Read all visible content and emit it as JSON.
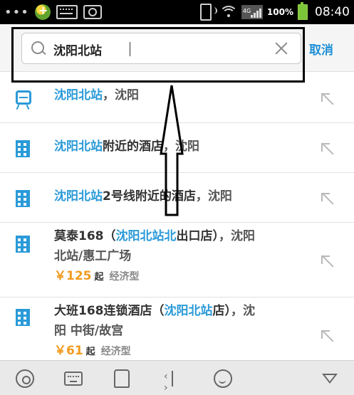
{
  "status_bar": {
    "overflow_dots": "•••",
    "battery_percent": "100%",
    "time": "08:40",
    "network_label": "4G",
    "icons": [
      "app-notification-icon",
      "keyboard-icon",
      "screenshot-icon",
      "phone-vibrate-icon",
      "wifi-icon",
      "signal-icon",
      "battery-icon"
    ]
  },
  "search": {
    "value": "沈阳北站",
    "cancel_label": "取消"
  },
  "results": [
    {
      "icon": "subway-icon",
      "parts": [
        {
          "t": "沈阳北站",
          "hl": true
        },
        {
          "t": "，沈阳",
          "hl": false
        }
      ]
    },
    {
      "icon": "building-icon",
      "parts": [
        {
          "t": "沈阳北站",
          "hl": true
        },
        {
          "t": "附近的酒店",
          "hl": false,
          "dark": true
        },
        {
          "t": "，沈阳",
          "hl": false
        }
      ]
    },
    {
      "icon": "building-icon",
      "parts": [
        {
          "t": "沈阳北站",
          "hl": true
        },
        {
          "t": "2号线附近的酒店",
          "hl": false,
          "dark": true
        },
        {
          "t": "，沈阳",
          "hl": false
        }
      ]
    },
    {
      "icon": "building-icon",
      "line1": [
        {
          "t": "莫泰168（",
          "dark": true
        },
        {
          "t": "沈阳北站北",
          "hl": true
        },
        {
          "t": "出口店）",
          "dark": true
        },
        {
          "t": "，沈阳",
          "hl": false
        }
      ],
      "line2": "北站/惠工广场",
      "price": "￥125",
      "qi": "起",
      "type": "经济型"
    },
    {
      "icon": "building-icon",
      "line1": [
        {
          "t": "大班168连锁酒店（",
          "dark": true
        },
        {
          "t": "沈阳北站",
          "hl": true
        },
        {
          "t": "店）",
          "dark": true
        },
        {
          "t": "，沈",
          "hl": false
        }
      ],
      "line2": "阳 中街/故宫",
      "price": "￥61",
      "qi": "起",
      "type": "经济型"
    }
  ],
  "keyboard_bar": {
    "icons": [
      "settings-gear-icon",
      "keyboard-layout-icon",
      "skin-shirt-icon",
      "cursor-move-icon",
      "emoji-icon",
      "hide-keyboard-icon"
    ]
  },
  "colors": {
    "accent": "#2a9ad8",
    "price": "#f29b21",
    "status_bar": "#000000"
  }
}
